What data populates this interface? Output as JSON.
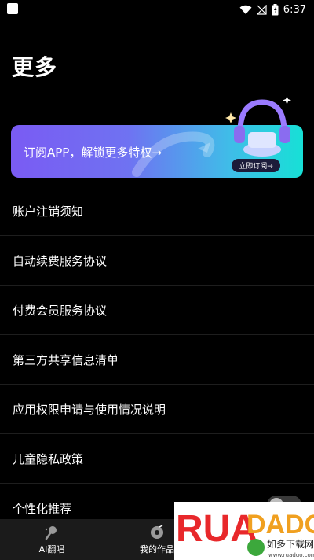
{
  "status_bar": {
    "time": "6:37"
  },
  "title": "更多",
  "banner": {
    "text": "订阅APP，解锁更多特权→",
    "button": "立即订阅→",
    "colors": {
      "start": "#7a5bf3",
      "end": "#17e0d6"
    }
  },
  "menu": {
    "items": [
      {
        "label": "账户注销须知"
      },
      {
        "label": "自动续费服务协议"
      },
      {
        "label": "付费会员服务协议"
      },
      {
        "label": "第三方共享信息清单"
      },
      {
        "label": "应用权限申请与使用情况说明"
      },
      {
        "label": "儿童隐私政策"
      },
      {
        "label": "个性化推荐"
      }
    ]
  },
  "tabs": [
    {
      "label": "AI翻唱",
      "icon": "ai-cover-icon"
    },
    {
      "label": "我的作品",
      "icon": "my-works-icon"
    }
  ],
  "watermark": {
    "text": "RUADADO",
    "subtext": "如多下载网",
    "url": "www.ruaduo.com"
  }
}
